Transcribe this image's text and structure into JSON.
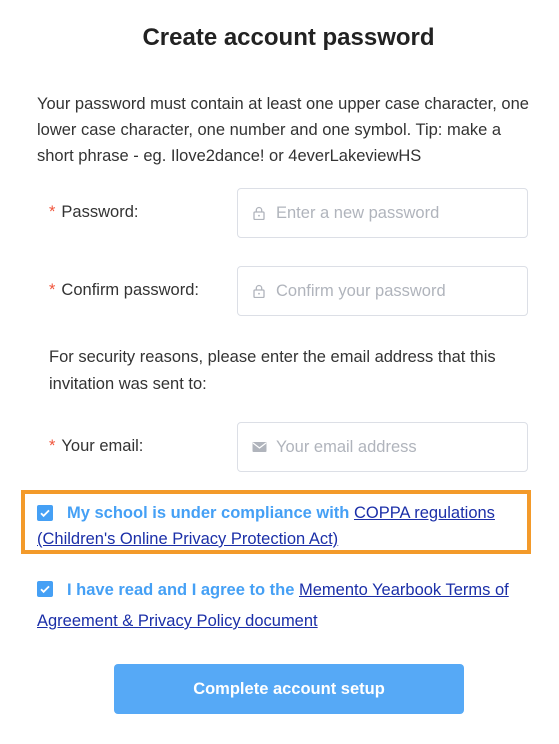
{
  "page": {
    "title": "Create account password",
    "intro": "Your password must contain at least one upper case character, one lower case character, one number and one symbol. Tip: make a short phrase - eg. Ilove2dance! or 4everLakeviewHS"
  },
  "form": {
    "required_marker": "*",
    "password": {
      "label": "Password:",
      "placeholder": "Enter a new password",
      "icon": "lock-icon"
    },
    "confirm_password": {
      "label": "Confirm password:",
      "placeholder": "Confirm your password",
      "icon": "lock-icon"
    },
    "security_note": "For security reasons, please enter the email address that this invitation was sent to:",
    "email": {
      "label": "Your email:",
      "placeholder": "Your email address",
      "icon": "mail-icon"
    }
  },
  "agreements": {
    "coppa": {
      "checked": true,
      "text": "My school is under compliance with ",
      "link_text": "COPPA regulations (Children's Online Privacy Protection Act)"
    },
    "terms": {
      "checked": true,
      "text": "I have read and I agree to the ",
      "link_text": "Memento Yearbook Terms of Agreement & Privacy Policy document"
    }
  },
  "submit_label": "Complete account setup",
  "colors": {
    "accent": "#45a0f5",
    "button": "#56a9f6",
    "link": "#1b2fa8",
    "required": "#f0553c",
    "highlight_border": "#f39a2a"
  }
}
